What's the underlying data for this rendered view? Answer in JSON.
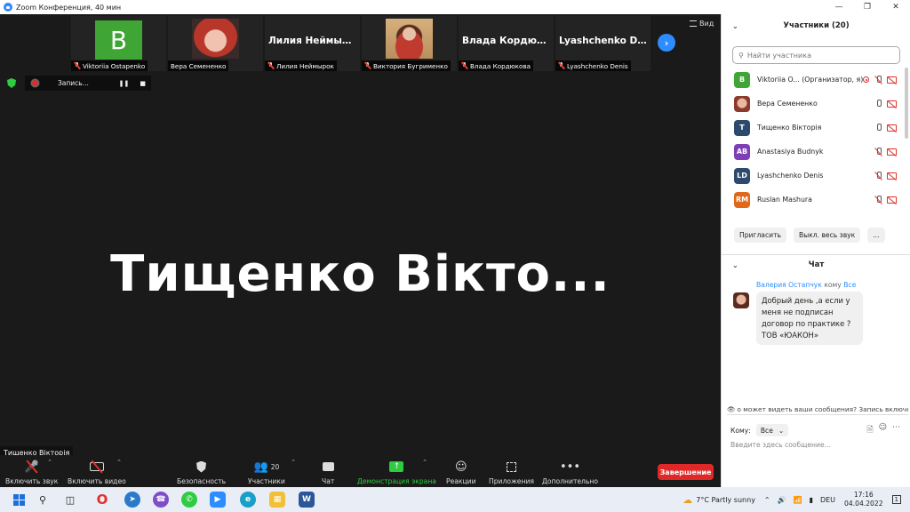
{
  "window": {
    "title": "Zoom Конференция, 40 мин",
    "controls": [
      "—",
      "❐",
      "✕"
    ]
  },
  "thumbnails": [
    {
      "name": "Viktoriia Ostapenko",
      "type": "avatar",
      "initial": "B",
      "muted": true
    },
    {
      "name": "Вера Семененко",
      "type": "photo",
      "muted": false
    },
    {
      "name": "Лилия Неймырок",
      "type": "text",
      "display": "Лилия  Неймыр...",
      "muted": true
    },
    {
      "name": "Виктория Бугрименко",
      "type": "photo",
      "muted": true
    },
    {
      "name": "Влада Кордюкова",
      "type": "text",
      "display": "Влада  Кордюк...",
      "muted": true
    },
    {
      "name": "Lyashchenko Denis",
      "type": "text",
      "display": "Lyashchenko  De...",
      "muted": true
    }
  ],
  "view_label": "Вид",
  "recording": {
    "label": "Запись...",
    "pause": "❚❚",
    "stop": "■"
  },
  "speaker": {
    "big_name": "Тищенко  Вікто...",
    "label": "Тищенко Вікторія"
  },
  "toolbar": {
    "audio": "Включить звук",
    "video": "Включить видео",
    "security": "Безопасность",
    "participants": "Участники",
    "participants_count": "20",
    "chat": "Чат",
    "share": "Демонстрация экрана",
    "reactions": "Реакции",
    "apps": "Приложения",
    "more": "Дополнительно",
    "end": "Завершение"
  },
  "panel": {
    "title": "Участники (20)",
    "search_placeholder": "Найти участника",
    "participants": [
      {
        "initials": "B",
        "name": "Viktoriia O...  (Организатор, я)",
        "color": "#3fa535",
        "mic": "off",
        "rec": true
      },
      {
        "initials": "",
        "name": "Вера Семененко",
        "color": "photo",
        "mic": "on",
        "rec": false
      },
      {
        "initials": "T",
        "name": "Тищенко Вікторія",
        "color": "#2c4a6e",
        "mic": "on",
        "rec": false
      },
      {
        "initials": "AB",
        "name": "Anastasiya Budnyk",
        "color": "#7e3fb5",
        "mic": "off",
        "rec": false
      },
      {
        "initials": "LD",
        "name": "Lyashchenko Denis",
        "color": "#2c4a6e",
        "mic": "off",
        "rec": false
      },
      {
        "initials": "RM",
        "name": "Ruslan Mashura",
        "color": "#e0681a",
        "mic": "off",
        "rec": false
      }
    ],
    "invite": "Пригласить",
    "mute_all": "Выкл. весь звук",
    "more": "..."
  },
  "chat": {
    "title": "Чат",
    "from": "Валерия Остапчук",
    "to_word": "кому",
    "to_target": "Все",
    "message": "Добрый день ,а если у меня не подписан договор по практике ? ТОВ «ЮАКОН»",
    "notice": "о может видеть ваши сообщения? Запись включен",
    "to_label": "Кому:",
    "to_value": "Все",
    "input_placeholder": "Введите здесь сообщение..."
  },
  "taskbar": {
    "weather": "7°C  Partly sunny",
    "lang": "DEU",
    "time": "17:16",
    "date": "04.04.2022",
    "notifications": "1"
  }
}
